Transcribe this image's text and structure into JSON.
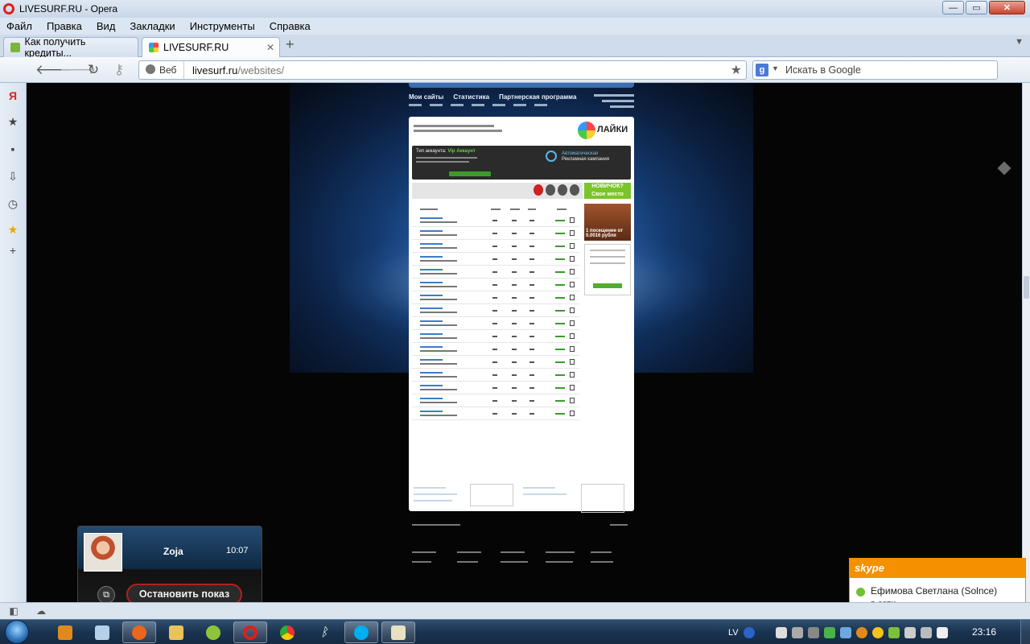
{
  "window": {
    "title": "LIVESURF.RU - Opera",
    "controls": {
      "minimize": "—",
      "maximize": "▭",
      "close": "✕"
    }
  },
  "menu": [
    "Файл",
    "Правка",
    "Вид",
    "Закладки",
    "Инструменты",
    "Справка"
  ],
  "tabs": [
    {
      "label": "Как получить кредиты...",
      "active": false
    },
    {
      "label": "LIVESURF.RU",
      "active": true
    }
  ],
  "address": {
    "scheme_label": "Веб",
    "domain": "livesurf.ru",
    "path": "/websites/"
  },
  "search": {
    "engine_icon": "g-icon",
    "placeholder": "Искать в Google"
  },
  "site": {
    "nav": [
      "Мои сайты",
      "Статистика",
      "Партнерская программа"
    ],
    "logo": "ЛАЙКИ",
    "account_label": "Тип аккаунта:",
    "account_type": "Vip Аккаунт",
    "campaign_title": "Автоматическая",
    "campaign_subtitle": "Рекламная кампания",
    "newbie": "НОВИЧОК? Свое место выше",
    "ad_text": "1 посещение от 0.0016 рубля"
  },
  "skype_toast": {
    "brand": "skype",
    "contact": "Ефимова Светлана (Solnce)",
    "status": "в сети"
  },
  "call_popup": {
    "name": "Zoja",
    "time": "10:07",
    "stop_label": "Остановить показ"
  },
  "taskbar": {
    "language": "LV",
    "clock": "23:16"
  },
  "colors": {
    "opera_red": "#d9211c",
    "skype_orange": "#f59100",
    "online_green": "#6fc234"
  }
}
